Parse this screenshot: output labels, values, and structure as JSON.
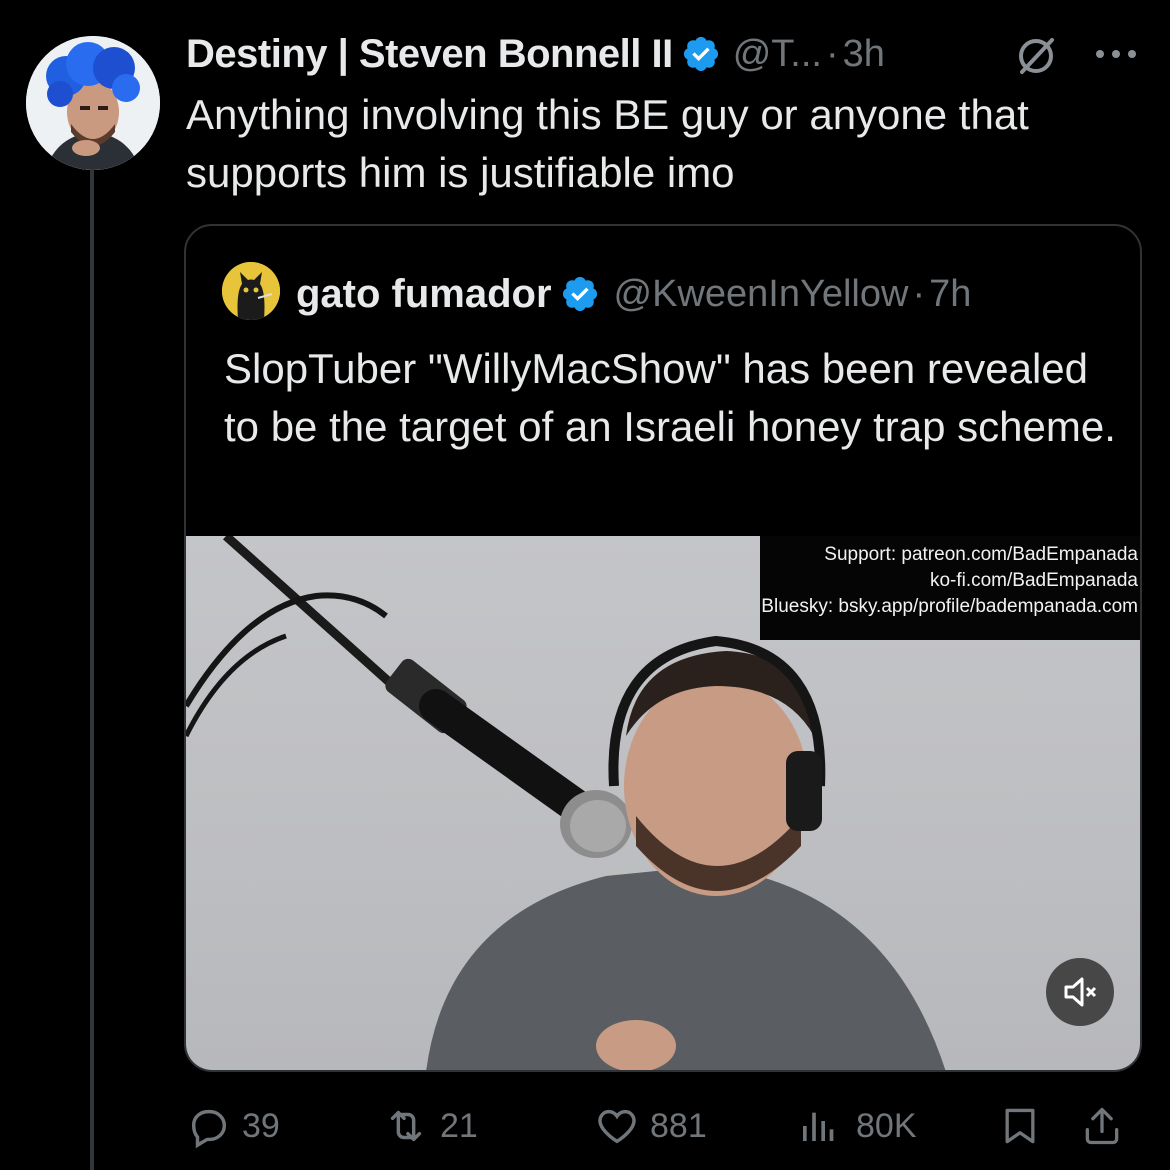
{
  "tweet": {
    "author_name": "Destiny | Steven Bonnell II",
    "handle": "@T...",
    "separator": "·",
    "time": "3h",
    "text": "Anything involving this BE guy or anyone that supports him is justifiable imo",
    "icons": {
      "verified": "verified-badge-icon",
      "grok": "grok-icon",
      "more": "more-icon"
    }
  },
  "quote": {
    "author_name": "gato fumador",
    "handle": "@KweenInYellow",
    "separator": "·",
    "time": "7h",
    "text": "SlopTuber \"WillyMacShow\" has been revealed to be the target of an Israeli honey trap scheme.",
    "media": {
      "overlay_lines": [
        "Support: patreon.com/BadEmpanada",
        "ko-fi.com/BadEmpanada",
        "Bluesky: bsky.app/profile/badempanada.com"
      ],
      "mute_icon": "volume-muted-icon"
    }
  },
  "actions": {
    "replies": "39",
    "retweets": "21",
    "likes": "881",
    "views": "80K"
  },
  "colors": {
    "background": "#000000",
    "text_primary": "#e7e9ea",
    "text_secondary": "#71767b",
    "verified_blue": "#1d9bf0",
    "border": "#2f3336"
  }
}
